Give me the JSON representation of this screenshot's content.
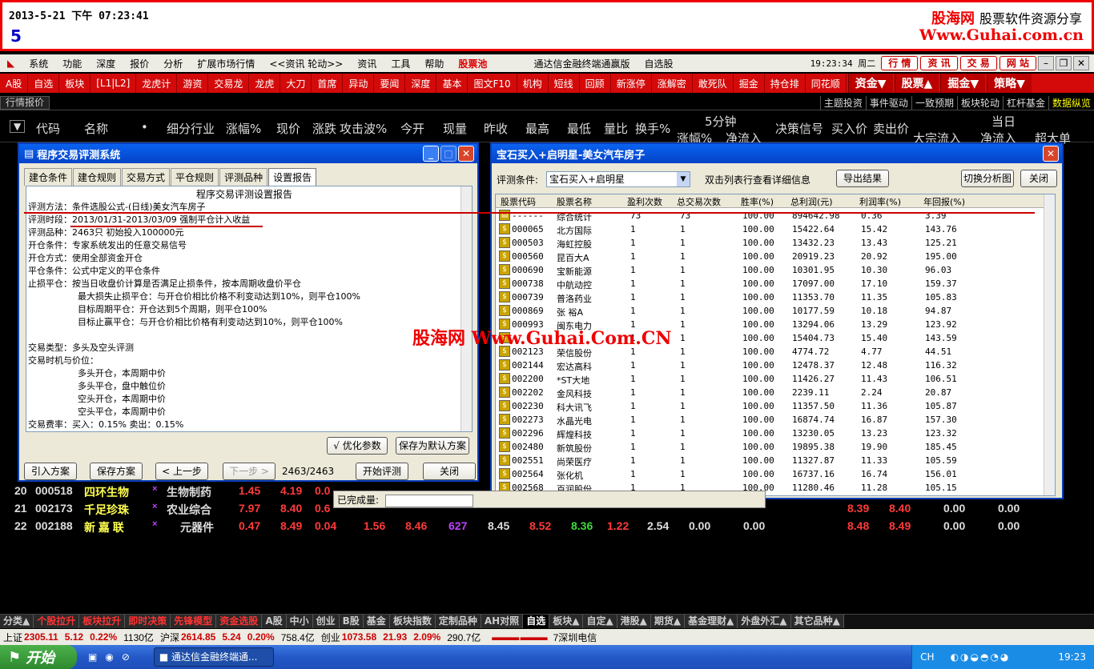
{
  "banner": {
    "datetime": "2013-5-21 下午 07:23:41",
    "number": "5",
    "logo_cn": "股海网",
    "logo_tag": "股票软件资源分享",
    "logo_url": "Www.Guhai.com.cn"
  },
  "menu": {
    "items": [
      "系统",
      "功能",
      "深度",
      "报价",
      "分析",
      "扩展市场行情",
      "<<资讯 轮动>>",
      "资讯",
      "工具",
      "帮助"
    ],
    "pool": "股票池",
    "app_title": "通达信金融终端通赢版",
    "section": "自选股",
    "clock": "19:23:34 周二",
    "right_buttons": [
      "行 情",
      "资 讯",
      "交 易",
      "网 站"
    ]
  },
  "toolbar": {
    "items": [
      "A股",
      "自选",
      "板块",
      "[L1|L2]",
      "龙虎计",
      "游资",
      "交易龙",
      "龙虎",
      "大刀",
      "首席",
      "异动",
      "要闻",
      "深度",
      "基本",
      "图文F10",
      "机构",
      "短线",
      "回顾",
      "新涨停",
      "涨解密",
      "敢死队",
      "掘金",
      "持仓排",
      "同花顺"
    ],
    "dropdowns": [
      "资金▼",
      "股票▲",
      "掘金▼",
      "策略▼"
    ]
  },
  "row3": {
    "tag": "行情报价",
    "right": [
      "主题投资",
      "事件驱动",
      "一致预期",
      "板块轮动",
      "杠杆基金",
      "数据纵览"
    ]
  },
  "columns": {
    "labels": [
      "代码",
      "名称",
      "•",
      "细分行业",
      "涨幅%",
      "现价",
      "涨跌",
      "攻击波%",
      "今开",
      "现量",
      "昨收",
      "最高",
      "最低",
      "量比",
      "换手%",
      "5分钟",
      "涨幅%",
      "净流入",
      "决策信号",
      "买入价",
      "卖出价",
      "大宗流入",
      "当日",
      "净流入",
      "超大单"
    ]
  },
  "stocks": [
    {
      "idx": "20",
      "code": "000518",
      "name": "四环生物",
      "mark": "×",
      "industry": "生物制药",
      "pct": "1.45",
      "price": "4.19",
      "chg": "0.0"
    },
    {
      "idx": "21",
      "code": "002173",
      "name": "千足珍珠",
      "mark": "×",
      "industry": "农业综合",
      "pct": "7.97",
      "price": "8.40",
      "chg": "0.6",
      "buy": "8.39",
      "sell": "8.40",
      "v1": "0.00",
      "v2": "0.00"
    },
    {
      "idx": "22",
      "code": "002188",
      "name": "新 嘉 联",
      "mark": "×",
      "industry": "元器件",
      "pct": "0.47",
      "price": "8.49",
      "chg": "0.04",
      "atk": "1.56",
      "open": "8.46",
      "vol": "627",
      "prev": "8.45",
      "high": "8.52",
      "low": "8.36",
      "lb": "1.22",
      "turn": "2.54",
      "f1": "0.00",
      "f2": "0.00",
      "buy": "8.48",
      "sell": "8.49",
      "v1": "0.00",
      "v2": "0.00"
    }
  ],
  "dlg_left": {
    "title": "程序交易评测系统",
    "tabs": [
      "建仓条件",
      "建仓规则",
      "交易方式",
      "平仓规则",
      "评测品种",
      "设置报告"
    ],
    "report_title": "程序交易评测设置报告",
    "lines": [
      "评测方法：条件选股公式-(日线)美女汽车房子",
      "评测时段：2013/01/31-2013/03/09 强制平仓计入收益",
      "评测品种：2463只 初始投入100000元",
      "开仓条件：专家系统发出的任意交易信号",
      "开仓方式：使用全部资金开仓",
      "平仓条件：公式中定义的平仓条件",
      "止损平仓：按当日收盘价计算是否满足止损条件，按本周期收盘价平仓",
      "最大损失止损平仓：与开仓价相比价格不利变动达到10%，则平仓100%",
      "目标周期平仓：开仓达到5个周期，则平仓100%",
      "目标止赢平仓：与开仓价相比价格有利变动达到10%，则平仓100%",
      "",
      "交易类型：多头及空头评测",
      "交易时机与价位：",
      "多头开仓，本周期中价",
      "多头平仓，盘中触位价",
      "空头开仓，本周期中价",
      "空头平仓，本周期中价",
      "交易费率：买入：0.15%   卖出：0.15%"
    ],
    "optimize": "√ 优化参数",
    "save_default": "保存为默认方案",
    "import": "引入方案",
    "save": "保存方案",
    "prev": "< 上一步",
    "next": "下一步 >",
    "count": "2463/2463",
    "start": "开始评测",
    "close": "关闭"
  },
  "dlg_right": {
    "title": "宝石买入+启明星-美女汽车房子",
    "cond_label": "评测条件:",
    "cond_value": "宝石买入+启明星",
    "hint": "双击列表行查看详细信息",
    "export": "导出结果",
    "switch": "切换分析图",
    "close": "关闭",
    "headers": [
      "股票代码",
      "股票名称",
      "盈利次数",
      "总交易次数",
      "胜率(%)",
      "总利润(元)",
      "利润率(%)",
      "年回报(%)"
    ],
    "rows": [
      [
        "------",
        "综合统计",
        "73",
        "73",
        "100.00",
        "894642.98",
        "0.36",
        "3.39"
      ],
      [
        "000065",
        "北方国际",
        "1",
        "1",
        "100.00",
        "15422.64",
        "15.42",
        "143.76"
      ],
      [
        "000503",
        "海虹控股",
        "1",
        "1",
        "100.00",
        "13432.23",
        "13.43",
        "125.21"
      ],
      [
        "000560",
        "昆百大A",
        "1",
        "1",
        "100.00",
        "20919.23",
        "20.92",
        "195.00"
      ],
      [
        "000690",
        "宝新能源",
        "1",
        "1",
        "100.00",
        "10301.95",
        "10.30",
        "96.03"
      ],
      [
        "000738",
        "中航动控",
        "1",
        "1",
        "100.00",
        "17097.00",
        "17.10",
        "159.37"
      ],
      [
        "000739",
        "普洛药业",
        "1",
        "1",
        "100.00",
        "11353.70",
        "11.35",
        "105.83"
      ],
      [
        "000869",
        "张 裕A",
        "1",
        "1",
        "100.00",
        "10177.59",
        "10.18",
        "94.87"
      ],
      [
        "000993",
        "闽东电力",
        "1",
        "1",
        "100.00",
        "13294.06",
        "13.29",
        "123.92"
      ],
      [
        "",
        "",
        "1",
        "1",
        "100.00",
        "15404.73",
        "15.40",
        "143.59"
      ],
      [
        "002123",
        "荣信股份",
        "1",
        "1",
        "100.00",
        "4774.72",
        "4.77",
        "44.51"
      ],
      [
        "002144",
        "宏达高科",
        "1",
        "1",
        "100.00",
        "12478.37",
        "12.48",
        "116.32"
      ],
      [
        "002200",
        "*ST大地",
        "1",
        "1",
        "100.00",
        "11426.27",
        "11.43",
        "106.51"
      ],
      [
        "002202",
        "金风科技",
        "1",
        "1",
        "100.00",
        "2239.11",
        "2.24",
        "20.87"
      ],
      [
        "002230",
        "科大讯飞",
        "1",
        "1",
        "100.00",
        "11357.50",
        "11.36",
        "105.87"
      ],
      [
        "002273",
        "水晶光电",
        "1",
        "1",
        "100.00",
        "16874.74",
        "16.87",
        "157.30"
      ],
      [
        "002296",
        "辉煌科技",
        "1",
        "1",
        "100.00",
        "13230.05",
        "13.23",
        "123.32"
      ],
      [
        "002480",
        "新筑股份",
        "1",
        "1",
        "100.00",
        "19895.38",
        "19.90",
        "185.45"
      ],
      [
        "002551",
        "尚荣医疗",
        "1",
        "1",
        "100.00",
        "11327.87",
        "11.33",
        "105.59"
      ],
      [
        "002564",
        "张化机",
        "1",
        "1",
        "100.00",
        "16737.16",
        "16.74",
        "156.01"
      ],
      [
        "002568",
        "百润股份",
        "1",
        "1",
        "100.00",
        "11280.46",
        "11.28",
        "105.15"
      ]
    ],
    "done_label": "已完成量:"
  },
  "watermark": "股海网 Www.Guhai.Com.CN",
  "bottom_tabs": [
    "分类▲",
    "个股拉升",
    "板块拉升",
    "即时决策",
    "先锋模型",
    "资金选股",
    "A股",
    "中小",
    "创业",
    "B股",
    "基金",
    "板块指数",
    "定制品种",
    "AH对照",
    "自选",
    "板块▲",
    "自定▲",
    "港股▲",
    "期货▲",
    "基金理财▲",
    "外盘外汇▲",
    "其它品种▲"
  ],
  "status": {
    "sh_label": "上证",
    "sh": "2305.11",
    "sh_chg": "5.12",
    "sh_pct": "0.22%",
    "sh_amt": "1130亿",
    "sz_label": "沪深",
    "sz": "2614.85",
    "sz_chg": "5.24",
    "sz_pct": "0.20%",
    "sz_amt": "758.4亿",
    "cy_label": "创业",
    "cy": "1073.58",
    "cy_chg": "21.93",
    "cy_pct": "2.09%",
    "cy_amt": "290.7亿",
    "broker": "7深圳电信"
  },
  "taskbar": {
    "start": "开始",
    "task": "通达信金融终端通...",
    "lang": "CH",
    "time": "19:23"
  },
  "colors": {
    "up": "#ff3a3a",
    "down": "#3cdc3c",
    "accent": "#d40a0a",
    "purple": "#c040ff"
  }
}
